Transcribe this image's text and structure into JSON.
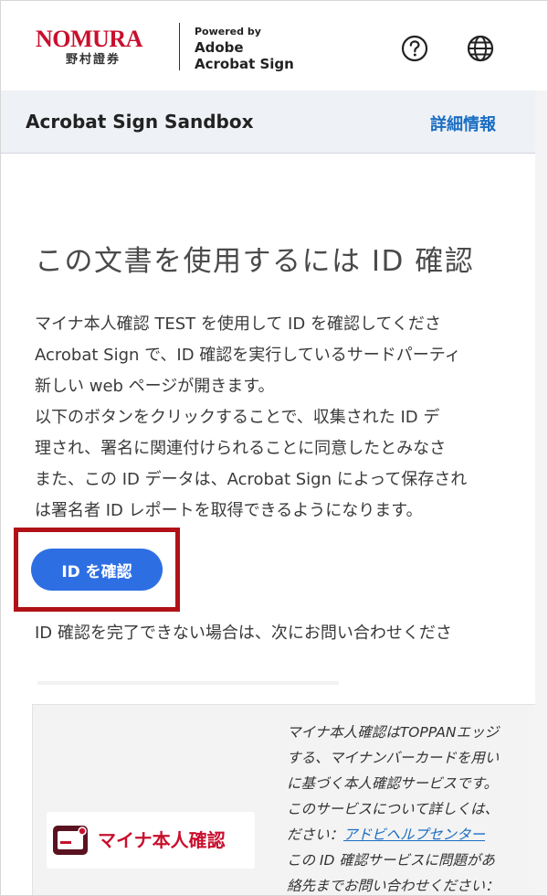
{
  "header": {
    "brand_name": "NOMURA",
    "brand_subname": "野村證券",
    "powered_by": "Powered by",
    "powered_product_line1": "Adobe",
    "powered_product_line2": "Acrobat Sign",
    "help_icon": "help-circle-icon",
    "language_icon": "globe-icon"
  },
  "sandbox_bar": {
    "title": "Acrobat Sign Sandbox",
    "details_link": "詳細情報"
  },
  "main": {
    "heading": "この文書を使用するには ID 確認",
    "paragraph_lines": [
      "マイナ本人確認 TEST を使用して ID を確認してくださ",
      "Acrobat Sign で、ID 確認を実行しているサードパーティ",
      "新しい web ページが開きます。",
      "以下のボタンをクリックすることで、収集された ID デ",
      "理され、署名に関連付けられることに同意したとみなさ",
      "また、この ID データは、Acrobat Sign によって保存され",
      "は署名者 ID レポートを取得できるようになります。"
    ],
    "verify_button": "ID を確認",
    "contact_text": "ID 確認を完了できない場合は、次にお問い合わせくださ"
  },
  "info_panel": {
    "logo_text": "マイナ本人確認",
    "lines": [
      "マイナ本人確認はTOPPANエッジ",
      "する、マイナンバーカードを用い",
      "に基づく本人確認サービスです。",
      "このサービスについて詳しくは、",
      "ださい：",
      "この ID 確認サービスに問題があ",
      "絡先までお問い合わせください："
    ],
    "help_link": "アドビヘルプセンター"
  },
  "colors": {
    "brand_red": "#c8102e",
    "accent_blue": "#2d6fe3",
    "link_blue": "#1a6ec3",
    "highlight_red": "#b01217",
    "sandbox_bg": "#eef1f6"
  }
}
